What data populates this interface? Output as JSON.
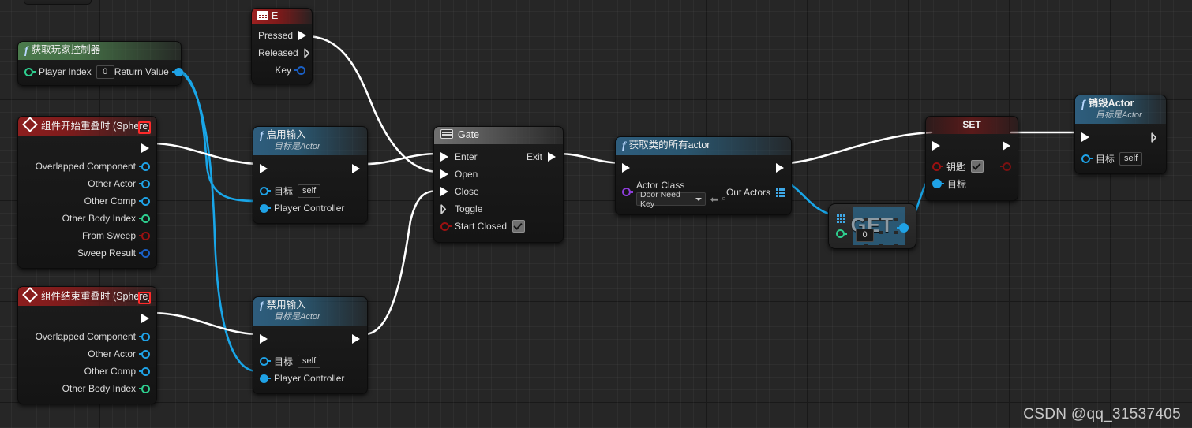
{
  "app": {
    "watermark": "CSDN @qq_31537405",
    "canvas_bg": "#262626",
    "wire_exec_color": "#ffffff",
    "wire_data_color": "#19a6e8"
  },
  "nodes": {
    "get_player_controller": {
      "title": "获取玩家控制器",
      "inputs": [
        {
          "label": "Player Index",
          "value": "0",
          "pin": "int-hollow"
        }
      ],
      "outputs": [
        {
          "label": "Return Value",
          "pin": "object-filled"
        }
      ]
    },
    "key_e": {
      "title": "E",
      "icon": "keyboard-icon",
      "outputs": [
        {
          "label": "Pressed",
          "pin": "exec-filled"
        },
        {
          "label": "Released",
          "pin": "exec-hollow"
        },
        {
          "label": "Key",
          "pin": "struct-hollow"
        }
      ]
    },
    "begin_overlap": {
      "title": "组件开始重叠时 (Sphere)",
      "outputs": [
        {
          "label": "",
          "pin": "exec-hollow"
        },
        {
          "label": "Overlapped Component",
          "pin": "object-hollow"
        },
        {
          "label": "Other Actor",
          "pin": "object-hollow"
        },
        {
          "label": "Other Comp",
          "pin": "object-hollow"
        },
        {
          "label": "Other Body Index",
          "pin": "int-hollow"
        },
        {
          "label": "From Sweep",
          "pin": "bool-hollow"
        },
        {
          "label": "Sweep Result",
          "pin": "struct-hollow"
        }
      ]
    },
    "end_overlap": {
      "title": "组件结束重叠时 (Sphere)",
      "outputs": [
        {
          "label": "",
          "pin": "exec-hollow"
        },
        {
          "label": "Overlapped Component",
          "pin": "object-hollow"
        },
        {
          "label": "Other Actor",
          "pin": "object-hollow"
        },
        {
          "label": "Other Comp",
          "pin": "object-hollow"
        },
        {
          "label": "Other Body Index",
          "pin": "int-hollow"
        }
      ]
    },
    "enable_input": {
      "title": "启用输入",
      "subtitle": "目标是Actor",
      "inputs": [
        {
          "label": "目标",
          "value": "self",
          "pin": "object-hollow"
        },
        {
          "label": "Player Controller",
          "pin": "object-filled"
        }
      ]
    },
    "disable_input": {
      "title": "禁用输入",
      "subtitle": "目标是Actor",
      "inputs": [
        {
          "label": "目标",
          "value": "self",
          "pin": "object-hollow"
        },
        {
          "label": "Player Controller",
          "pin": "object-filled"
        }
      ]
    },
    "gate": {
      "title": "Gate",
      "icon": "gate-icon",
      "inputs": [
        {
          "label": "Enter",
          "pin": "exec-filled"
        },
        {
          "label": "Open",
          "pin": "exec-filled"
        },
        {
          "label": "Close",
          "pin": "exec-filled"
        },
        {
          "label": "Toggle",
          "pin": "exec-hollow"
        },
        {
          "label": "Start Closed",
          "pin": "bool-hollow",
          "checked": true
        }
      ],
      "outputs": [
        {
          "label": "Exit",
          "pin": "exec-filled"
        }
      ]
    },
    "get_all_actors": {
      "title": "获取类的所有actor",
      "inputs": [
        {
          "label": "Actor Class",
          "value": "Door Need Key",
          "pin": "class-hollow"
        }
      ],
      "outputs": [
        {
          "label": "Out Actors",
          "pin": "array-grid"
        }
      ]
    },
    "get_array": {
      "title": "GET",
      "index_value": "0"
    },
    "set_node": {
      "title": "SET",
      "inputs": [
        {
          "label": "钥匙",
          "pin": "bool-hollow",
          "checked": true
        },
        {
          "label": "目标",
          "pin": "object-filled"
        }
      ],
      "outputs": [
        {
          "label": "",
          "pin": "bool-hollow"
        }
      ]
    },
    "destroy_actor": {
      "title": "销毁Actor",
      "subtitle": "目标是Actor",
      "inputs": [
        {
          "label": "目标",
          "value": "self",
          "pin": "object-hollow"
        }
      ]
    }
  }
}
